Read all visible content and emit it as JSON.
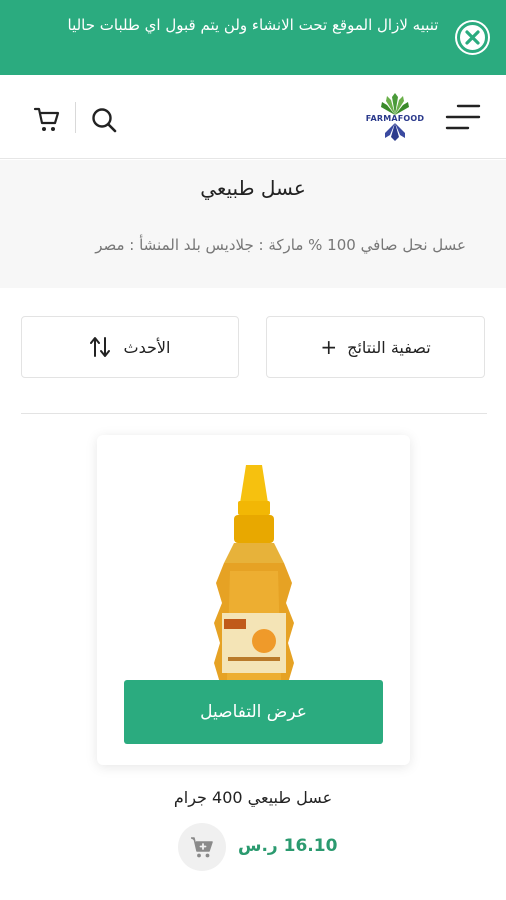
{
  "banner": {
    "text": "تنبيه لازال الموقع تحت الانشاء ولن يتم قبول اي طلبات حاليا",
    "color": "#2bab7f"
  },
  "header": {
    "logo_text": "FARMAFOOD",
    "icons": [
      "cart-icon",
      "search-icon",
      "menu-icon"
    ]
  },
  "category": {
    "title": "عسل طبيعي",
    "description": "عسل نحل صافي 100 % ماركة : جلاديس بلد المنشأ : مصر"
  },
  "toolbar": {
    "sort_label": "الأحدث",
    "filter_label": "تصفية النتائج",
    "filter_plus": "+"
  },
  "product": {
    "details_button": "عرض التفاصيل",
    "name": "عسل طبيعي 400 جرام",
    "price": "16.10 ر.س",
    "accent_color": "#2b9a6f"
  }
}
